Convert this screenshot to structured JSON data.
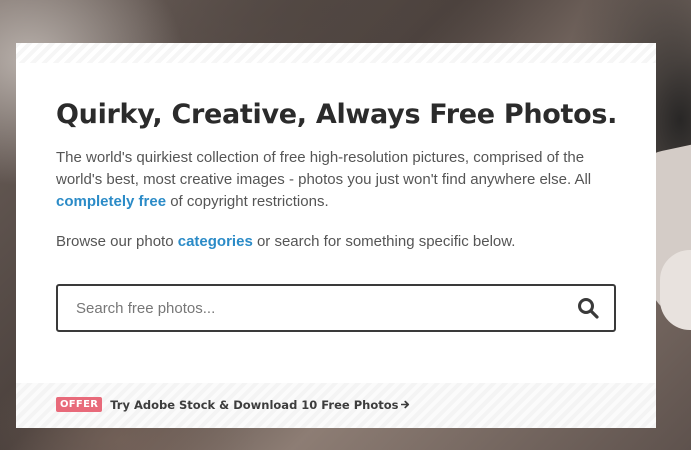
{
  "hero": {
    "title": "Quirky, Creative, Always Free Photos.",
    "description_part1": "The world's quirkiest collection of free high-resolution pictures, comprised of the world's best, most creative images - photos you just won't find anywhere else. All ",
    "description_link": "completely free",
    "description_part2": " of copyright restrictions.",
    "browse_part1": "Browse our photo ",
    "browse_link": "categories",
    "browse_part2": " or search for something specific below."
  },
  "search": {
    "placeholder": "Search free photos...",
    "value": "",
    "button_icon": "search-icon"
  },
  "offer": {
    "badge": "OFFER",
    "link_text": "Try Adobe Stock & Download 10 Free Photos",
    "arrow_icon": "arrow-right-icon"
  },
  "colors": {
    "link": "#2b8bc7",
    "badge": "#e86a7a",
    "title": "#2b2b2b"
  }
}
